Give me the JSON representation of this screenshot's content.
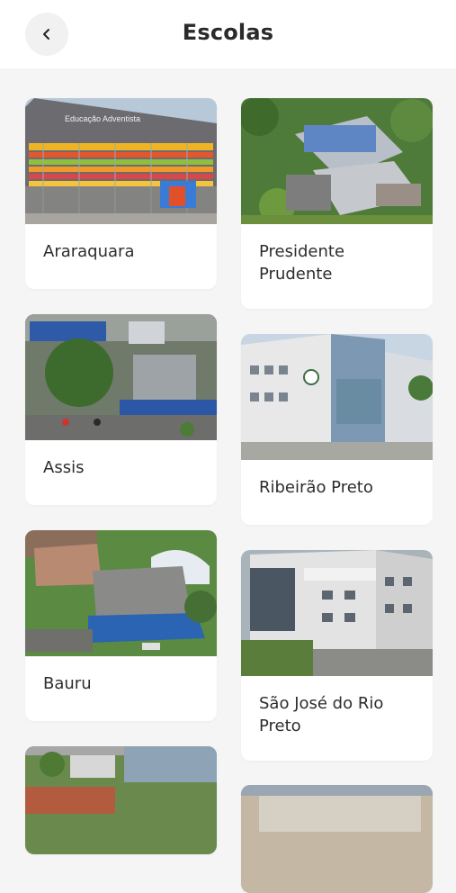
{
  "header": {
    "title": "Escolas",
    "back_icon": "chevron-left-icon"
  },
  "schools": [
    {
      "name": "Araraquara",
      "sign": "Educação Adventista"
    },
    {
      "name": "Presidente Prudente"
    },
    {
      "name": "Assis"
    },
    {
      "name": "Ribeirão Preto"
    },
    {
      "name": "Bauru"
    },
    {
      "name": "São José do Rio Preto"
    },
    {
      "name": ""
    },
    {
      "name": ""
    }
  ]
}
